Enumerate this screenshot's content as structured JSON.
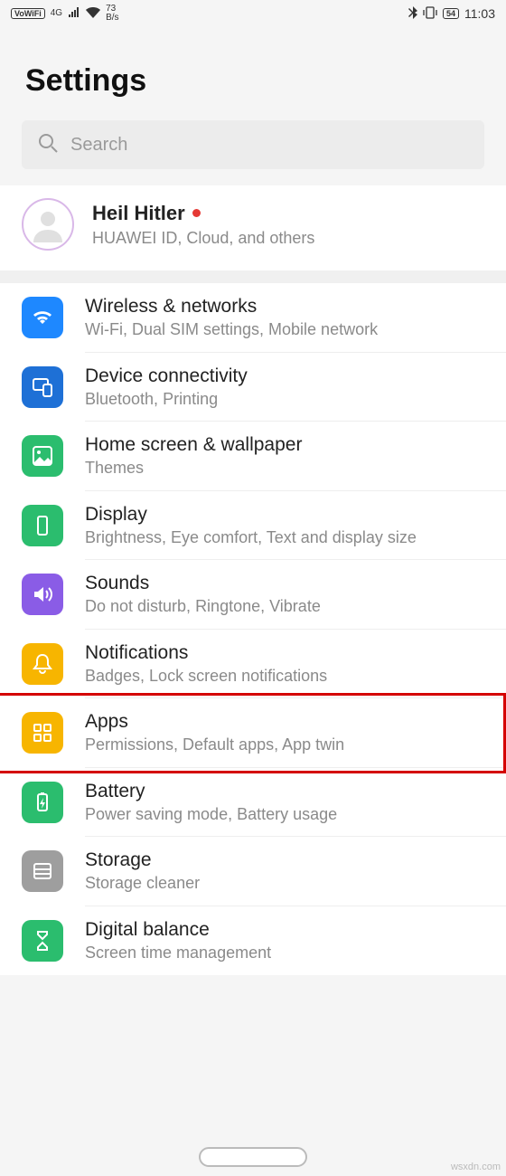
{
  "status": {
    "vowifi": "VoWiFi",
    "net_gen": "4G",
    "speed_top": "73",
    "speed_bot": "B/s",
    "battery": "54",
    "time": "11:03"
  },
  "header": {
    "title": "Settings"
  },
  "search": {
    "placeholder": "Search"
  },
  "account": {
    "name": "Heil Hitler",
    "sub": "HUAWEI ID, Cloud, and others"
  },
  "items": [
    {
      "key": "wireless",
      "title": "Wireless & networks",
      "sub": "Wi-Fi, Dual SIM settings, Mobile network",
      "color": "#1e88ff",
      "icon": "wifi"
    },
    {
      "key": "device",
      "title": "Device connectivity",
      "sub": "Bluetooth, Printing",
      "color": "#1e70d6",
      "icon": "devices"
    },
    {
      "key": "home",
      "title": "Home screen & wallpaper",
      "sub": "Themes",
      "color": "#2bbd6e",
      "icon": "picture"
    },
    {
      "key": "display",
      "title": "Display",
      "sub": "Brightness, Eye comfort, Text and display size",
      "color": "#2bbd6e",
      "icon": "phone"
    },
    {
      "key": "sounds",
      "title": "Sounds",
      "sub": "Do not disturb, Ringtone, Vibrate",
      "color": "#8a5ce6",
      "icon": "sound"
    },
    {
      "key": "notif",
      "title": "Notifications",
      "sub": "Badges, Lock screen notifications",
      "color": "#f7b500",
      "icon": "bell"
    },
    {
      "key": "apps",
      "title": "Apps",
      "sub": "Permissions, Default apps, App twin",
      "color": "#f7b500",
      "icon": "grid",
      "highlighted": true
    },
    {
      "key": "battery",
      "title": "Battery",
      "sub": "Power saving mode, Battery usage",
      "color": "#2bbd6e",
      "icon": "battery"
    },
    {
      "key": "storage",
      "title": "Storage",
      "sub": "Storage cleaner",
      "color": "#9e9e9e",
      "icon": "storage"
    },
    {
      "key": "digital",
      "title": "Digital balance",
      "sub": "Screen time management",
      "color": "#2bbd6e",
      "icon": "hourglass"
    }
  ],
  "watermark": "wsxdn.com"
}
